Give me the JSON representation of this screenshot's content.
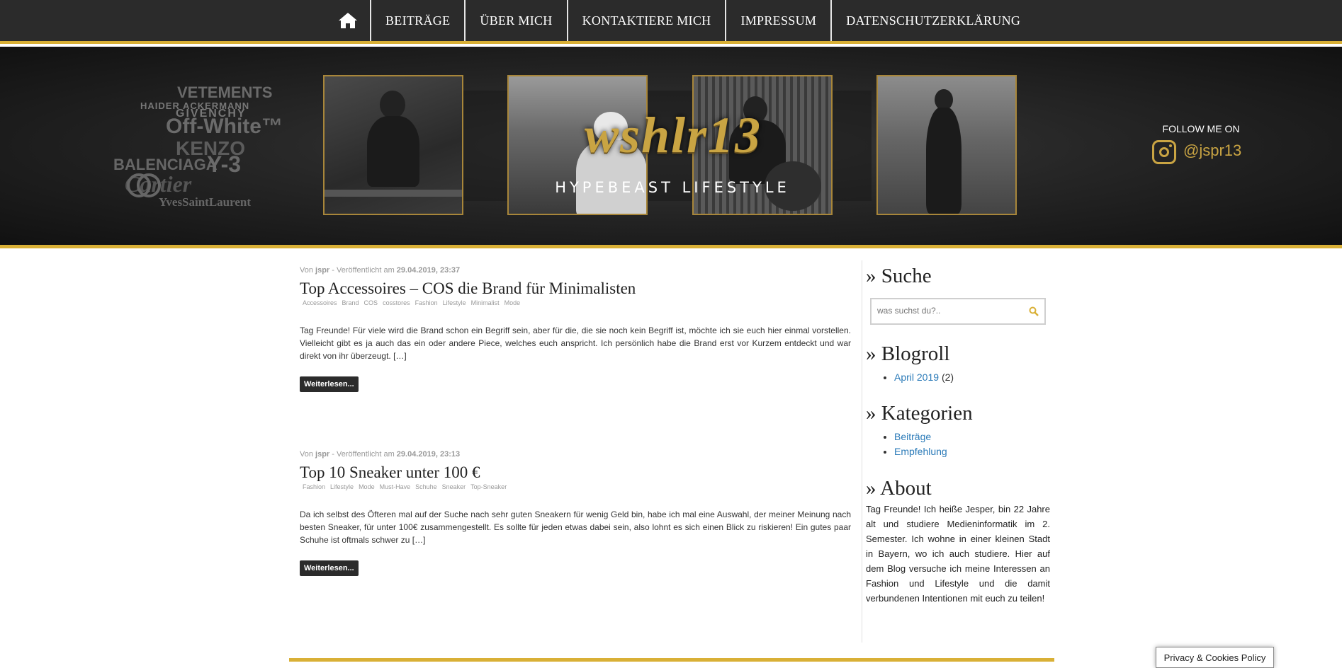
{
  "nav": {
    "home_icon": "home-icon",
    "items": [
      "BEITRÄGE",
      "ÜBER MICH",
      "KONTAKTIERE MICH",
      "IMPRESSUM",
      "DATENSCHUTZERKLÄRUNG"
    ]
  },
  "header": {
    "logo": "wshlr13",
    "tagline": "HYPEBEAST LIFESTYLE",
    "follow_label": "FOLLOW ME ON",
    "instagram_handle": "@jspr13",
    "brands": [
      "VETEMENTS",
      "HAIDER ACKERMANN",
      "GIVENCHY",
      "Off-White™",
      "KENZO",
      "BALENCIAGA",
      "Y-3",
      "Cartier",
      "YvesSaintLaurent"
    ]
  },
  "posts": [
    {
      "meta_prefix": "Von",
      "author": "jspr",
      "meta_mid": "- Veröffentlicht am",
      "date": "29.04.2019, 23:37",
      "title": "Top Accessoires – COS die Brand für Minimalisten",
      "tags": [
        "Accessoires",
        "Brand",
        "COS",
        "cosstores",
        "Fashion",
        "Lifestyle",
        "Minimalist",
        "Mode"
      ],
      "excerpt": "Tag Freunde! Für viele wird die Brand schon ein Begriff sein, aber für die, die sie noch kein Begriff ist, möchte ich sie euch hier einmal vorstellen. Vielleicht gibt es ja auch das ein oder andere Piece, welches euch anspricht. Ich persönlich habe die Brand erst vor Kurzem entdeckt und war direkt von ihr überzeugt. […]",
      "more": "Weiterlesen..."
    },
    {
      "meta_prefix": "Von",
      "author": "jspr",
      "meta_mid": "- Veröffentlicht am",
      "date": "29.04.2019, 23:13",
      "title": "Top 10 Sneaker unter 100 €",
      "tags": [
        "Fashion",
        "Lifestyle",
        "Mode",
        "Must-Have",
        "Schuhe",
        "Sneaker",
        "Top-Sneaker"
      ],
      "excerpt": "Da ich selbst des Öfteren mal auf der Suche nach sehr guten Sneakern für wenig Geld bin, habe ich mal eine Auswahl, der meiner Meinung nach besten Sneaker, für unter 100€ zusammengestellt. Es sollte für jeden etwas dabei sein, also lohnt es sich einen Blick zu riskieren! Ein gutes paar Schuhe ist oftmals schwer zu […]",
      "more": "Weiterlesen..."
    }
  ],
  "sidebar": {
    "search_title": "» Suche",
    "search_placeholder": "was suchst du?..",
    "blogroll_title": "» Blogroll",
    "blogroll": [
      {
        "label": "April 2019",
        "count": "(2)"
      }
    ],
    "categories_title": "» Kategorien",
    "categories": [
      "Beiträge",
      "Empfehlung"
    ],
    "about_title": "» About",
    "about_text": "Tag Freunde! Ich heiße Jesper, bin 22 Jahre alt und studiere Medieninformatik im 2. Semester. Ich wohne in einer kleinen Stadt in Bayern, wo ich auch studiere. Hier auf dem Blog versuche ich meine Interessen an Fashion und Lifestyle und die damit verbundenen Intentionen mit euch zu teilen!"
  },
  "cookie_button": "Privacy & Cookies Policy",
  "colors": {
    "accent": "#d9b036",
    "nav_bg": "#2b2b2b",
    "link": "#2a7ab8"
  }
}
